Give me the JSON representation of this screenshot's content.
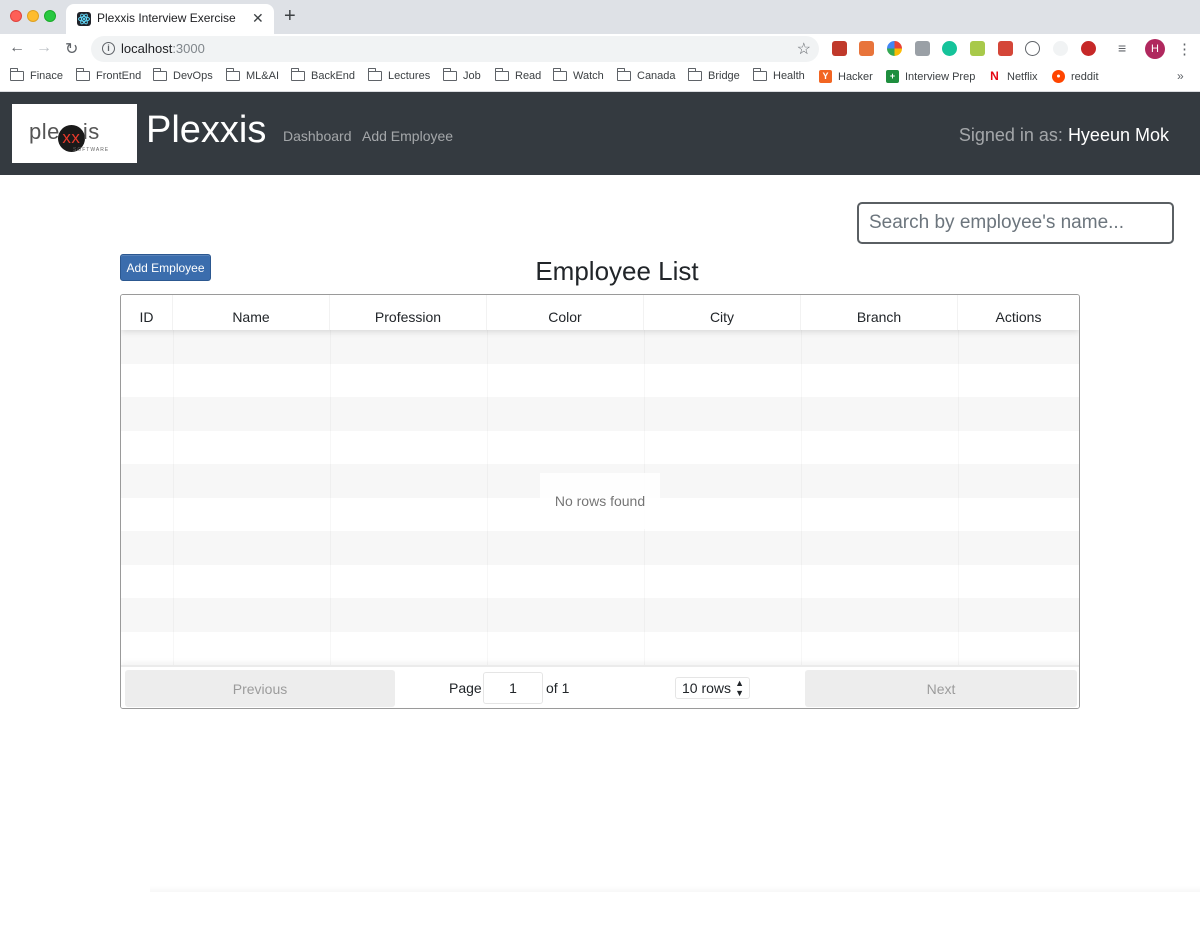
{
  "browser": {
    "tab_title": "Plexxis Interview Exercise",
    "tab_close": "✕",
    "new_tab": "+",
    "url_host": "localhost",
    "url_port": ":3000",
    "profile_initial": "H",
    "bookmarks": [
      {
        "label": "Finace",
        "type": "folder"
      },
      {
        "label": "FrontEnd",
        "type": "folder"
      },
      {
        "label": "DevOps",
        "type": "folder"
      },
      {
        "label": "ML&AI",
        "type": "folder"
      },
      {
        "label": "BackEnd",
        "type": "folder"
      },
      {
        "label": "Lectures",
        "type": "folder"
      },
      {
        "label": "Job",
        "type": "folder"
      },
      {
        "label": "Read",
        "type": "folder"
      },
      {
        "label": "Watch",
        "type": "folder"
      },
      {
        "label": "Canada",
        "type": "folder"
      },
      {
        "label": "Bridge",
        "type": "folder"
      },
      {
        "label": "Health",
        "type": "folder"
      },
      {
        "label": "Hacker",
        "type": "site",
        "icon": "Y",
        "color": "#f26522"
      },
      {
        "label": "Interview Prep",
        "type": "site",
        "icon": "+",
        "color": "#1e8e3e"
      },
      {
        "label": "Netflix",
        "type": "site",
        "icon": "N",
        "color": "#e50914"
      },
      {
        "label": "reddit",
        "type": "site",
        "icon": "●",
        "color": "#ff4500"
      }
    ],
    "bookmarks_more": "»"
  },
  "navbar": {
    "logo_text_left": "ple",
    "logo_text_xx": "xx",
    "logo_text_right": "is",
    "logo_sub": "SOFTWARE",
    "brand": "Plexxis",
    "links": [
      "Dashboard",
      "Add Employee"
    ],
    "signed_in_label": "Signed in as: ",
    "user_name": "Hyeeun Mok",
    "background": "#343a40"
  },
  "main": {
    "search_placeholder": "Search by employee's name...",
    "add_button": "Add Employee",
    "title": "Employee List",
    "accent": "#3b6dad"
  },
  "table": {
    "columns": [
      "ID",
      "Name",
      "Profession",
      "Color",
      "City",
      "Branch",
      "Actions"
    ],
    "empty_message": "No rows found",
    "pagination": {
      "previous": "Previous",
      "page_label": "Page",
      "current_page": "1",
      "of_label": "of 1",
      "rows_option": "10 rows",
      "next": "Next"
    }
  }
}
